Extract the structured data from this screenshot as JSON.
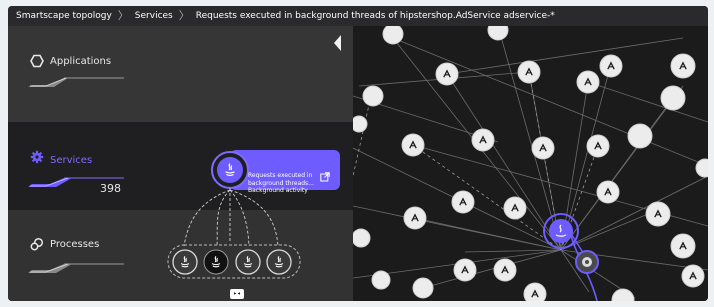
{
  "breadcrumb": {
    "items": [
      {
        "label": "Smartscape topology"
      },
      {
        "label": "Services"
      },
      {
        "label": "Requests executed in background threads of hipstershop.AdService adservice-*"
      }
    ]
  },
  "left_panel": {
    "applications": {
      "label": "Applications"
    },
    "services": {
      "label": "Services",
      "count": "398"
    },
    "processes": {
      "label": "Processes"
    },
    "selected_service": {
      "tooltip_lines": [
        "Requests executed in",
        "background threads...",
        "Background activity"
      ],
      "process_badge": "▸◂"
    }
  },
  "colors": {
    "accent": "#6f5cff",
    "panel": "#363636",
    "panel_selected": "#1f1f22",
    "canvas": "#1b1b1b"
  },
  "icons": [
    "hexagon-icon",
    "gear-icon",
    "processes-icon",
    "open-external-icon",
    "java-icon",
    "chevron-left-icon"
  ]
}
